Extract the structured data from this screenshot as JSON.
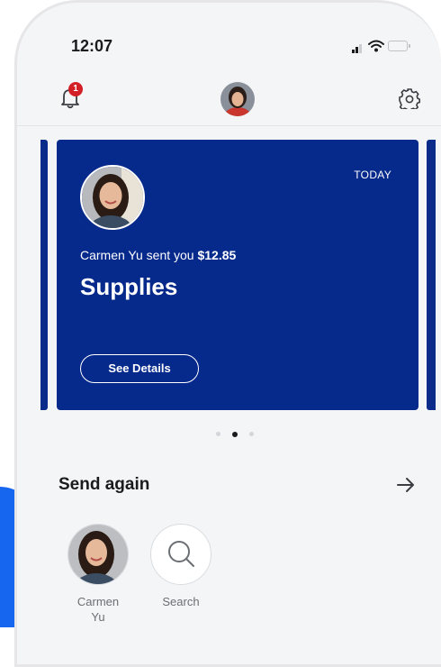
{
  "status_bar": {
    "time": "12:07"
  },
  "header": {
    "notification_count": "1"
  },
  "card": {
    "date": "TODAY",
    "message_prefix": "Carmen Yu sent you ",
    "amount": "$12.85",
    "title": "Supplies",
    "details_label": "See Details"
  },
  "pager": {
    "count": 3,
    "active_index": 1
  },
  "send_again": {
    "title": "Send again",
    "contacts": [
      {
        "name": "Carmen\nYu",
        "icon": "avatar"
      },
      {
        "name": "Search",
        "icon": "search-icon"
      }
    ]
  },
  "colors": {
    "card_background": "#06298c",
    "badge": "#d31f26",
    "accent_blue": "#1766f0",
    "app_background": "#f4f5f7"
  }
}
